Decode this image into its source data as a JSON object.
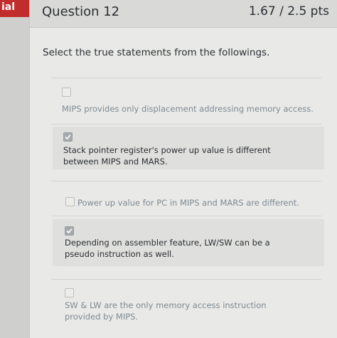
{
  "side_tab": {
    "label": "ial"
  },
  "question": {
    "title": "Question 12",
    "points": "1.67 / 2.5 pts",
    "prompt": "Select the true statements from the followings."
  },
  "answers": [
    {
      "text": "MIPS provides only displacement addressing memory access.",
      "checked": false
    },
    {
      "text": "Stack pointer register's power up value is different between MIPS and MARS.",
      "checked": true
    },
    {
      "text": "Power up value for PC in MIPS and MARS are different.",
      "checked": false
    },
    {
      "text": "Depending on assembler feature, LW/SW can be a pseudo instruction as well.",
      "checked": true
    },
    {
      "text": "SW & LW are the only memory access instruction provided by MIPS.",
      "checked": false
    }
  ]
}
